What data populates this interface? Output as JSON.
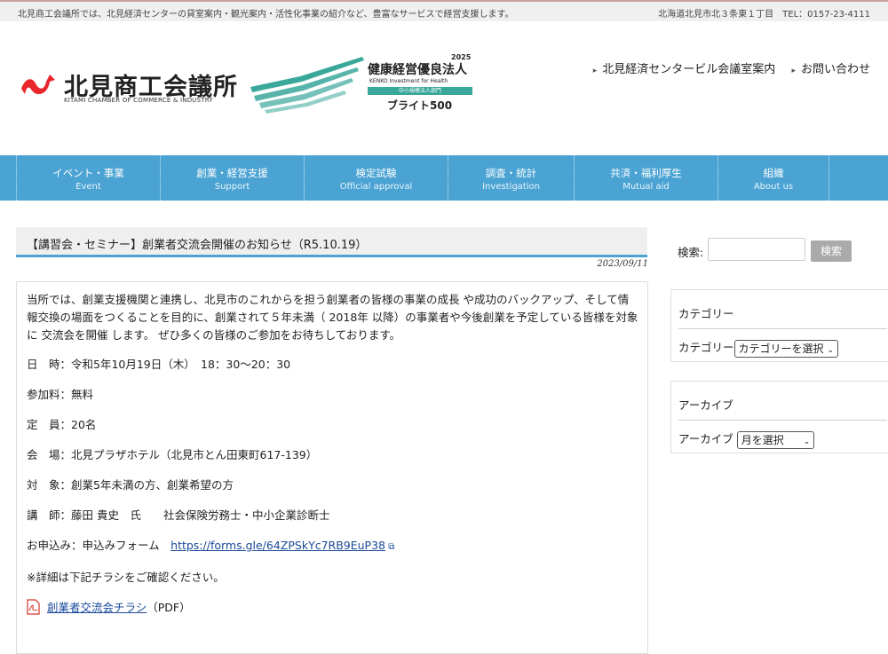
{
  "topbar": {
    "left_text": "北見商工会議所では、北見経済センターの貸室案内・観光案内・活性化事業の紹介など、豊富なサービスで経営支援します。",
    "right_text": "北海道北見市北３条東１丁目　TEL：0157-23-4111"
  },
  "logo": {
    "name_jp": "北見商工会議所",
    "name_en": "KITAMI CHAMBER OF COMMERCE & INDUSTRY"
  },
  "health_logo": {
    "year": "2025",
    "title": "健康経営優良法人",
    "subtitle": "KENKO Investment for Health",
    "band": "中小規模法人部門",
    "bright": "ブライト500"
  },
  "header_links": [
    {
      "label": "北見経済センタービル会議室案内",
      "icon": "chevron-right-icon"
    },
    {
      "label": "お問い合わせ",
      "icon": "chevron-right-icon"
    }
  ],
  "nav": [
    {
      "jp": "イベント・事業",
      "en": "Event"
    },
    {
      "jp": "創業・経営支援",
      "en": "Support"
    },
    {
      "jp": "検定試験",
      "en": "Official approval"
    },
    {
      "jp": "調査・統計",
      "en": "Investigation"
    },
    {
      "jp": "共済・福利厚生",
      "en": "Mutual aid"
    },
    {
      "jp": "組織",
      "en": "About us"
    }
  ],
  "post": {
    "title": "【講習会・セミナー】創業者交流会開催のお知らせ（R5.10.19）",
    "date": "2023/09/11",
    "intro": "当所では、創業支援機関と連携し、北見市のこれからを担う創業者の皆様の事業の成長 や成功のバックアップ、そして情報交換の場面をつくることを目的に、創業されて５年未満（ 2018年 以降）の事業者や今後創業を予定している皆様を対象に 交流会を開催 します。 ぜひ多くの皆様のご参加をお待ちしております。",
    "datetime": "日　時：令和5年10月19日（木）　18：30〜20：30",
    "fee": "参加料：無料",
    "capacity": "定　員：20名",
    "venue": "会　場：北見プラザホテル（北見市とん田東町617-139）",
    "target": "対　象：創業5年未満の方、創業希望の方",
    "lecturer": "講　師：藤田 貴史　氏　　社会保険労務士・中小企業診断士",
    "apply_prefix": "お申込み：申込みフォーム　",
    "apply_link": "https://forms.gle/64ZPSkYc7RB9EuP38",
    "note": "※詳細は下記チラシをご確認ください。",
    "flyer_link": "創業者交流会チラシ",
    "flyer_suffix": "（PDF）"
  },
  "sidebar": {
    "search_label": "検索:",
    "search_placeholder": "",
    "search_button": "検索",
    "category_title": "カテゴリー",
    "category_label": "カテゴリー",
    "category_select": "カテゴリーを選択",
    "archive_title": "アーカイブ",
    "archive_label": "アーカイブ",
    "archive_select": "月を選択"
  },
  "colors": {
    "nav_bg": "#4aa3d3",
    "title_underline": "#4aa3d3",
    "link": "#1a4a9a",
    "logo_red": "#e8262b",
    "health_green": "#3aa79b"
  }
}
